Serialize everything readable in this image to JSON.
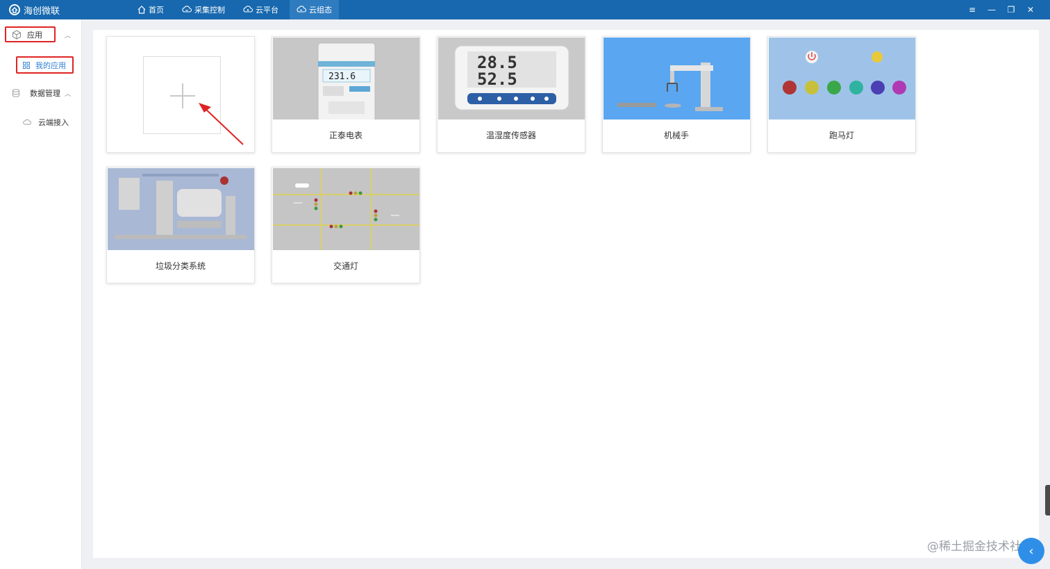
{
  "app": {
    "title": "海创微联"
  },
  "nav": {
    "items": [
      {
        "label": "首页",
        "icon": "home-icon"
      },
      {
        "label": "采集控制",
        "icon": "cloud-sync-icon"
      },
      {
        "label": "云平台",
        "icon": "cloud-platform-icon"
      },
      {
        "label": "云组态",
        "icon": "cloud-config-icon"
      }
    ],
    "active_index": 3
  },
  "window_controls": {
    "menu": "≡",
    "minimize": "—",
    "restore": "❐",
    "close": "✕"
  },
  "sidebar": {
    "app_group": "应用",
    "my_apps": "我的应用",
    "data_group": "数据管理",
    "cloud_access": "云端接入"
  },
  "cards": [
    {
      "label": "正泰电表",
      "image": "electric-meter"
    },
    {
      "label": "温湿度传感器",
      "image": "temp-humidity-sensor",
      "reading_top": "28.5",
      "reading_bottom": "52.5"
    },
    {
      "label": "机械手",
      "image": "robot-arm"
    },
    {
      "label": "跑马灯",
      "image": "marquee-lights"
    },
    {
      "label": "垃圾分类系统",
      "image": "waste-sorting-system"
    },
    {
      "label": "交通灯",
      "image": "traffic-light"
    }
  ],
  "meter_display": "231.6",
  "watermark": "@稀土掘金技术社区",
  "colors": {
    "topbar": "#1768ae",
    "highlight": "#e02424",
    "accent": "#2f8fe8"
  }
}
